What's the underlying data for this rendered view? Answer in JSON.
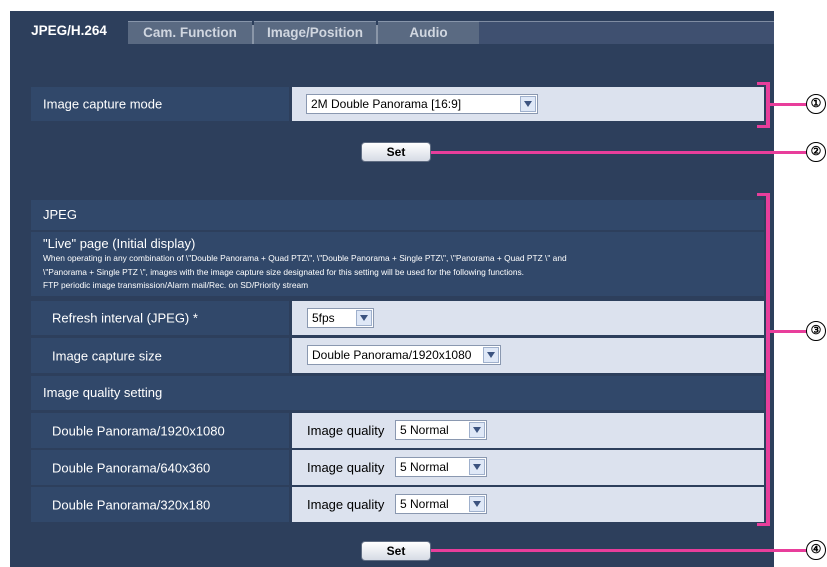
{
  "tabs": [
    {
      "label": "JPEG/H.264",
      "active": true
    },
    {
      "label": "Cam. Function",
      "active": false
    },
    {
      "label": "Image/Position",
      "active": false
    },
    {
      "label": "Audio",
      "active": false
    }
  ],
  "capture": {
    "label": "Image capture mode",
    "value": "2M Double Panorama [16:9]"
  },
  "set_label": "Set",
  "jpeg": {
    "header": "JPEG",
    "live_title": "\"Live\" page (Initial display)",
    "live_note_1": "When operating in any combination of \\\"Double Panorama + Quad PTZ\\\", \\\"Double Panorama + Single PTZ\\\", \\\"Panorama + Quad PTZ \\\" and",
    "live_note_2": "\\\"Panorama + Single PTZ \\\", images with the image capture size designated for this setting will be used for the following functions.",
    "live_note_3": "FTP periodic image transmission/Alarm mail/Rec. on SD/Priority stream",
    "refresh_label": "Refresh interval (JPEG) *",
    "refresh_value": "5fps",
    "size_label": "Image capture size",
    "size_value": "Double Panorama/1920x1080",
    "quality_header": "Image quality setting",
    "quality_rows": [
      {
        "label": "Double Panorama/1920x1080",
        "prefix": "Image quality",
        "value": "5 Normal"
      },
      {
        "label": "Double Panorama/640x360",
        "prefix": "Image quality",
        "value": "5 Normal"
      },
      {
        "label": "Double Panorama/320x180",
        "prefix": "Image quality",
        "value": "5 Normal"
      }
    ]
  },
  "callouts": [
    "①",
    "②",
    "③",
    "④"
  ],
  "colors": {
    "panel": "#2d3f5c",
    "row_label": "#31486a",
    "row_value": "#dce2ee",
    "callout_line": "#e83e9b"
  }
}
